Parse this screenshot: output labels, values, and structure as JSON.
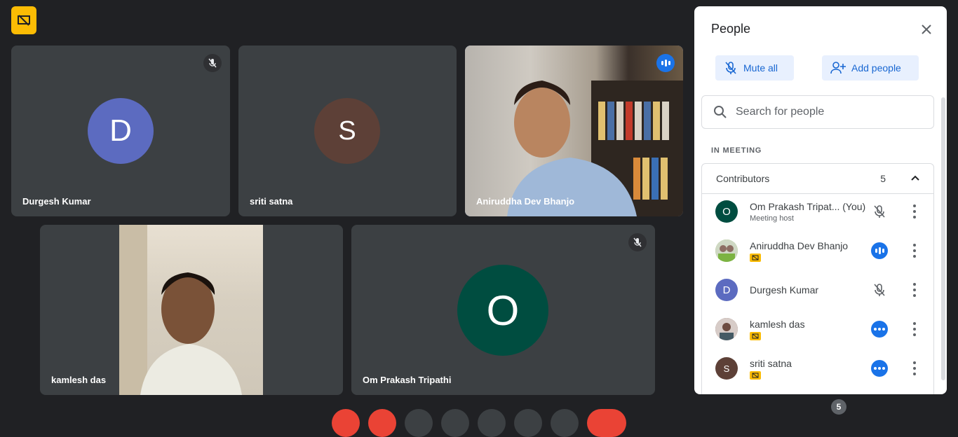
{
  "tiles": {
    "durgesh": {
      "name": "Durgesh Kumar",
      "initial": "D",
      "color": "#5c6bc0"
    },
    "sriti": {
      "name": "sriti satna",
      "initial": "S",
      "color": "#5d4037"
    },
    "aniruddha": {
      "name": "Aniruddha Dev Bhanjo"
    },
    "kamlesh": {
      "name": "kamlesh das"
    },
    "omprakash": {
      "name": "Om Prakash Tripathi",
      "initial": "O",
      "color": "#004d40"
    }
  },
  "panel": {
    "title": "People",
    "mute_all": "Mute all",
    "add_people": "Add people",
    "search_placeholder": "Search for people",
    "section": "IN MEETING",
    "group_label": "Contributors",
    "group_count": "5",
    "participants": [
      {
        "name": "Om Prakash Tripat...  (You)",
        "sub": "Meeting host",
        "initial": "O",
        "color": "#004d40",
        "status": "muted"
      },
      {
        "name": "Aniruddha Dev Bhanjo",
        "initial": "",
        "color": "#8bc34a",
        "status": "speaking"
      },
      {
        "name": "Durgesh Kumar",
        "initial": "D",
        "color": "#5c6bc0",
        "status": "muted"
      },
      {
        "name": "kamlesh das",
        "initial": "",
        "color": "#795548",
        "status": "more"
      },
      {
        "name": "sriti satna",
        "initial": "S",
        "color": "#5d4037",
        "status": "more"
      }
    ]
  },
  "bottom": {
    "participant_count": "5"
  }
}
